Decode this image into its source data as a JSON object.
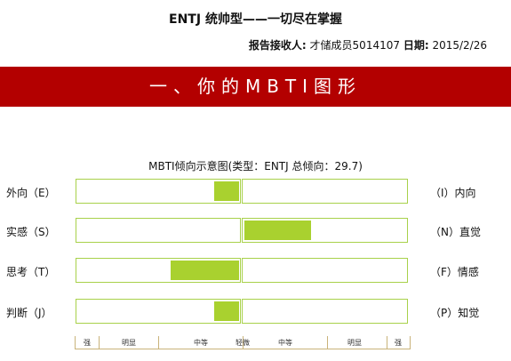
{
  "report_title": "ENTJ 统帅型——一切尽在掌握",
  "meta": {
    "recipient_label": "报告接收人:",
    "recipient_value": "才储成员5014107",
    "date_label": "日期:",
    "date_value": "2015/2/26"
  },
  "section_heading": "一、你的MBTI图形",
  "chart_data": {
    "type": "bar",
    "title": "MBTI倾向示意图(类型：ENTJ 总倾向：29.7)",
    "dimensions": [
      {
        "left": "外向（E）",
        "right": "（I）内向",
        "side": "left",
        "strength": 0.15
      },
      {
        "left": "实感（S）",
        "right": "（N）直觉",
        "side": "right",
        "strength": 0.41
      },
      {
        "left": "思考（T）",
        "right": "（F）情感",
        "side": "left",
        "strength": 0.42
      },
      {
        "left": "判断（J）",
        "right": "（P）知觉",
        "side": "left",
        "strength": 0.15
      }
    ],
    "scale_labels": [
      "强",
      "明显",
      "中等",
      "轻微",
      "中等",
      "明显",
      "强"
    ],
    "fill_color": "#a9d12f",
    "border_color": "#a8d14a"
  },
  "colors": {
    "banner": "#b30000"
  }
}
